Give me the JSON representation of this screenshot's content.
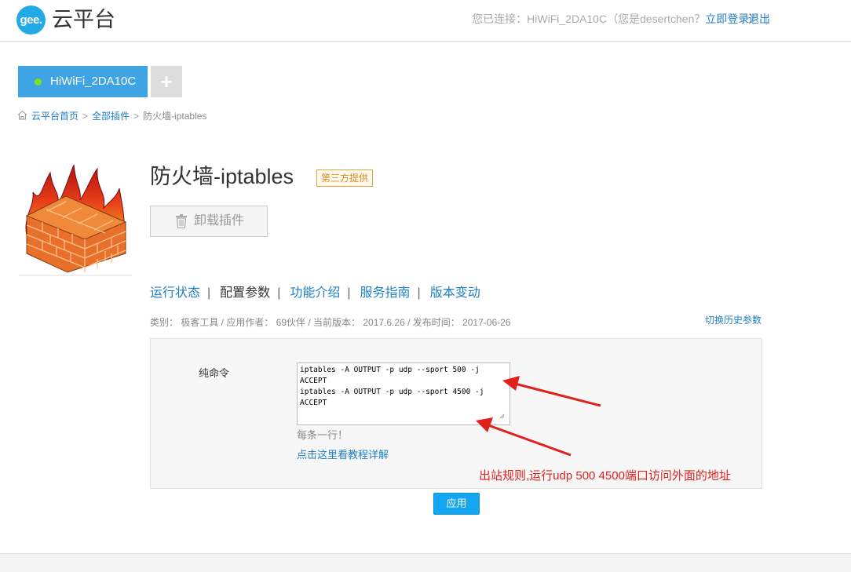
{
  "header": {
    "logo_text": "gee.",
    "brand": "云平台",
    "connected_prefix": "您已连接：HiWiFi_2DA10C（您是desertchen？",
    "login_link": "立即登录",
    "connected_suffix": "）",
    "separator": "|",
    "logout": "退出"
  },
  "device_tabs": {
    "active": "HiWiFi_2DA10C",
    "add": "+"
  },
  "breadcrumb": {
    "home": "云平台首页",
    "sep": ">",
    "all_plugins": "全部插件",
    "current": "防火墙-iptables"
  },
  "plugin": {
    "title": "防火墙-iptables",
    "badge": "第三方提供",
    "uninstall": "卸载插件"
  },
  "nav": {
    "items": [
      "运行状态",
      "配置参数",
      "功能介绍",
      "服务指南",
      "版本变动"
    ],
    "sep": "|"
  },
  "meta": {
    "text": "类别： 极客工具 / 应用作者： 69伙伴 / 当前版本： 2017.6.26 / 发布时间： 2017-06-26",
    "history": "切换历史参数"
  },
  "form": {
    "label": "纯命令",
    "command": "iptables -A OUTPUT -p udp --sport 500 -j\nACCEPT\niptables -A OUTPUT -p udp --sport 4500 -j\nACCEPT",
    "hint": "每条一行！",
    "tutorial_link": "点击这里看教程详解",
    "annotation": "出站规则,运行udp 500 4500端口访问外面的地址"
  },
  "apply_button": "应用",
  "colors": {
    "accent": "#14a6f0",
    "link": "#1f7fc4",
    "annotation": "#e0201b",
    "badge": "#e3a13a",
    "status_dot": "#7ce21b"
  },
  "icons": {
    "home": "home-icon",
    "trash": "trash-icon",
    "resize": "resize-grip-icon",
    "plugin": "firewall-brick-icon"
  }
}
